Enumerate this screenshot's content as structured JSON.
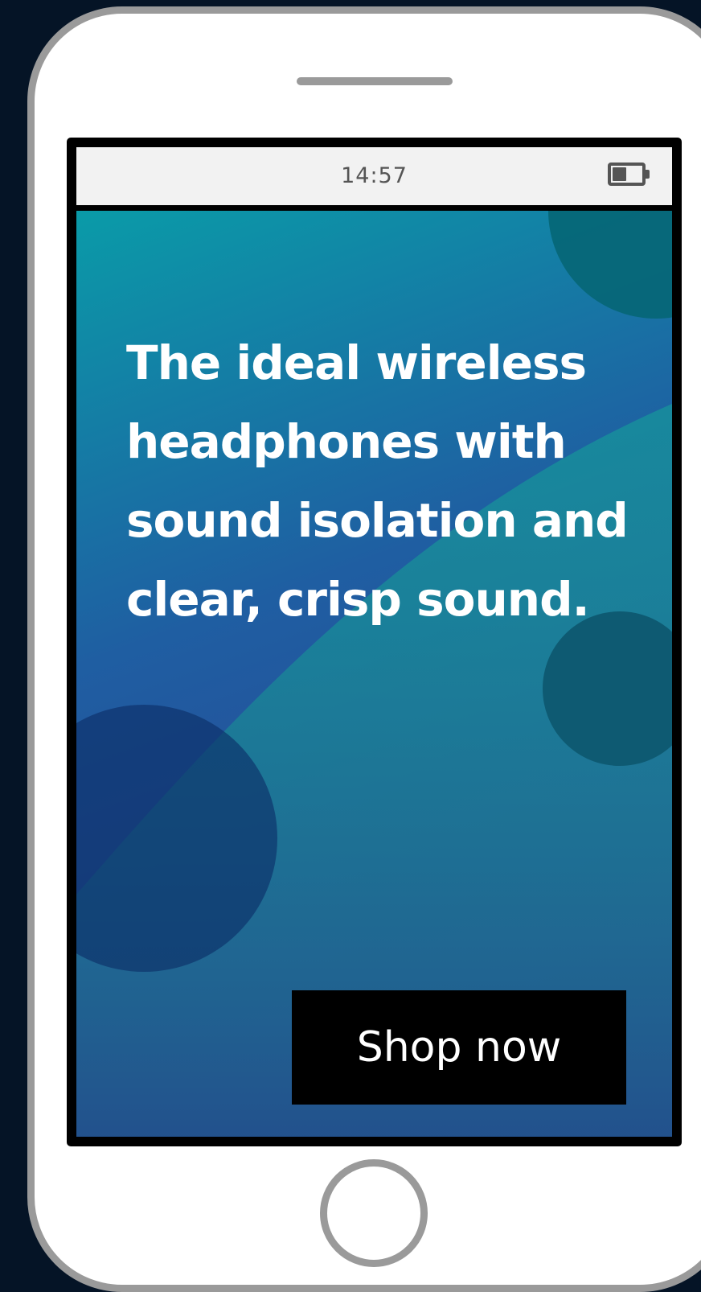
{
  "status_bar": {
    "time": "14:57",
    "battery_icon": "battery-icon"
  },
  "ad": {
    "headline": "The ideal wireless headphones with sound isolation and clear, crisp sound.",
    "cta_label": "Shop now"
  },
  "colors": {
    "background": "#051426",
    "phone_body": "#ffffff",
    "phone_outline": "#9a9a9a",
    "status_bar": "#f2f2f2",
    "gradient_teal": "#0a9ba8",
    "gradient_blue": "#25509a",
    "button": "#000000",
    "text": "#ffffff"
  }
}
